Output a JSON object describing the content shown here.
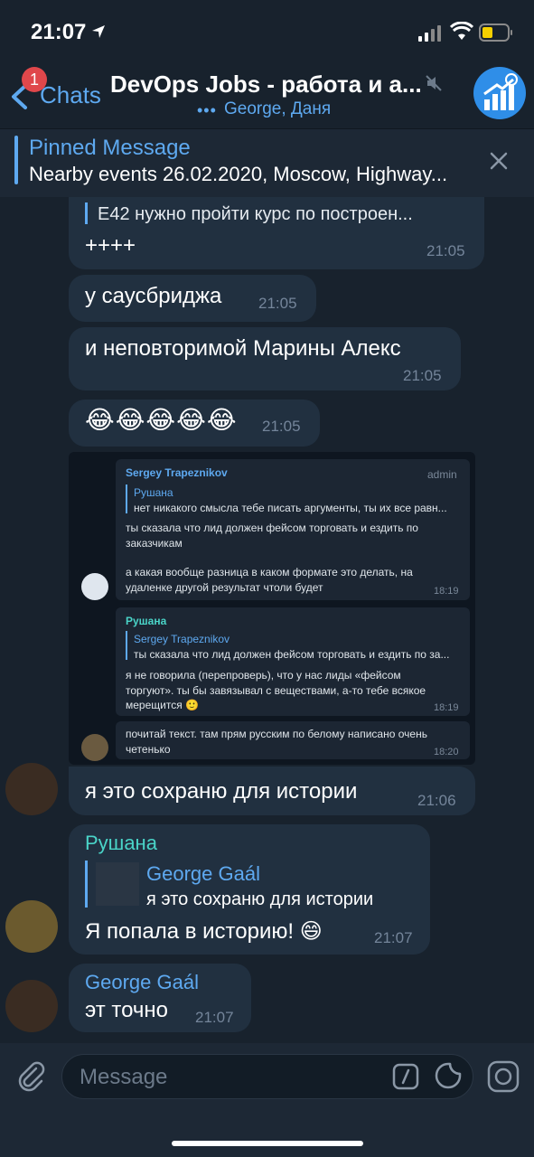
{
  "status_bar": {
    "time": "21:07"
  },
  "header": {
    "back_badge": "1",
    "back_label": "Chats",
    "title": "DevOps Jobs - работа и а...",
    "subtitle_dots": "•••",
    "subtitle": "George, Даня"
  },
  "pinned": {
    "title": "Pinned Message",
    "text": "Nearby events 26.02.2020, Moscow, Highway..."
  },
  "messages": [
    {
      "quote": "E42 нужно пройти курс по построен...",
      "text": "++++",
      "time": "21:05"
    },
    {
      "text": "у саусбриджа",
      "time": "21:05"
    },
    {
      "text": "и неповторимой Марины Алекс",
      "time": "21:05"
    },
    {
      "text": "😂😂😂😂😂",
      "time": "21:05"
    },
    {
      "text": "я это сохраню для истории",
      "time": "21:06"
    },
    {
      "sender": "Рушана",
      "quote_name": "George Gaál",
      "quote_text": "я это сохраню для истории",
      "text": "Я попала в историю! 😄",
      "time": "21:07"
    },
    {
      "sender": "George Gaál",
      "text": "эт точно",
      "time": "21:07"
    }
  ],
  "screenshot": {
    "m1": {
      "sender": "Sergey Trapeznikov",
      "role": "admin",
      "quote_name": "Рушана",
      "quote_text": "нет никакого смысла тебе писать аргументы, ты их все равн...",
      "line1": "ты сказала что лид должен фейсом торговать и ездить по",
      "line2": "заказчикам",
      "line3": "а какая вообще разница в каком формате это делать, на",
      "line4": "удаленке другой результат чтоли будет",
      "time": "18:19"
    },
    "m2": {
      "sender": "Рушана",
      "quote_name": "Sergey Trapeznikov",
      "quote_text": "ты сказала что лид должен фейсом торговать и ездить по за...",
      "line1": "я не говорила (перепроверь), что у нас лиды «фейсом",
      "line2": "торгуют». ты бы завязывал с веществами, а-то тебе всякое",
      "line3": "мерещится 🙂",
      "time": "18:19"
    },
    "m3": {
      "line1": "почитай текст. там прям русским по белому написано очень",
      "line2": "четенько",
      "time": "18:20"
    }
  },
  "input": {
    "placeholder": "Message"
  },
  "colors": {
    "accent": "#5ea9f0",
    "background": "#18222d",
    "bubble": "#213040",
    "sender_rushana": "#4ad4c8"
  }
}
